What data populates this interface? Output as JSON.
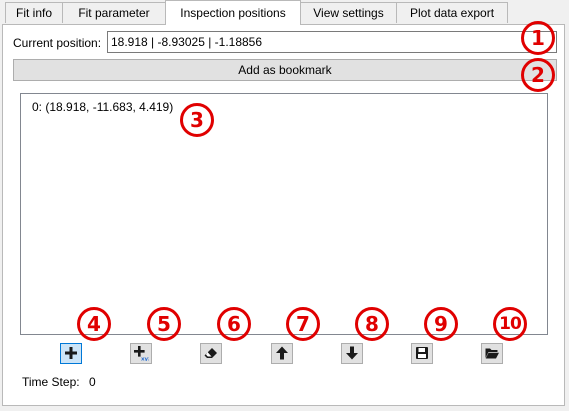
{
  "tabs": [
    {
      "label": "Fit info",
      "active": false
    },
    {
      "label": "Fit parameter",
      "active": false
    },
    {
      "label": "Inspection positions",
      "active": true
    },
    {
      "label": "View settings",
      "active": false
    },
    {
      "label": "Plot data export",
      "active": false
    }
  ],
  "current_position": {
    "label": "Current position:",
    "value": "18.918 | -8.93025 | -1.18856"
  },
  "bookmark_button": {
    "label": "Add as bookmark"
  },
  "bookmarks": [
    "0: (18.918, -11.683, 4.419)"
  ],
  "toolbar": [
    {
      "name": "add-bookmark",
      "icon": "plus-icon",
      "selected": true
    },
    {
      "name": "add-bookmark-xyz",
      "icon": "plus-xyz-icon",
      "selected": false
    },
    {
      "name": "erase",
      "icon": "eraser-icon",
      "selected": false
    },
    {
      "name": "move-up",
      "icon": "arrow-up-icon",
      "selected": false
    },
    {
      "name": "move-down",
      "icon": "arrow-down-icon",
      "selected": false
    },
    {
      "name": "save",
      "icon": "floppy-disk-icon",
      "selected": false
    },
    {
      "name": "open",
      "icon": "folder-open-icon",
      "selected": false
    }
  ],
  "time_step": {
    "label": "Time Step:",
    "value": "0"
  },
  "annotations": [
    "1",
    "2",
    "3",
    "4",
    "5",
    "6",
    "7",
    "8",
    "9",
    "10"
  ],
  "colors": {
    "annotation": "#e00000",
    "accent": "#0078d7"
  }
}
